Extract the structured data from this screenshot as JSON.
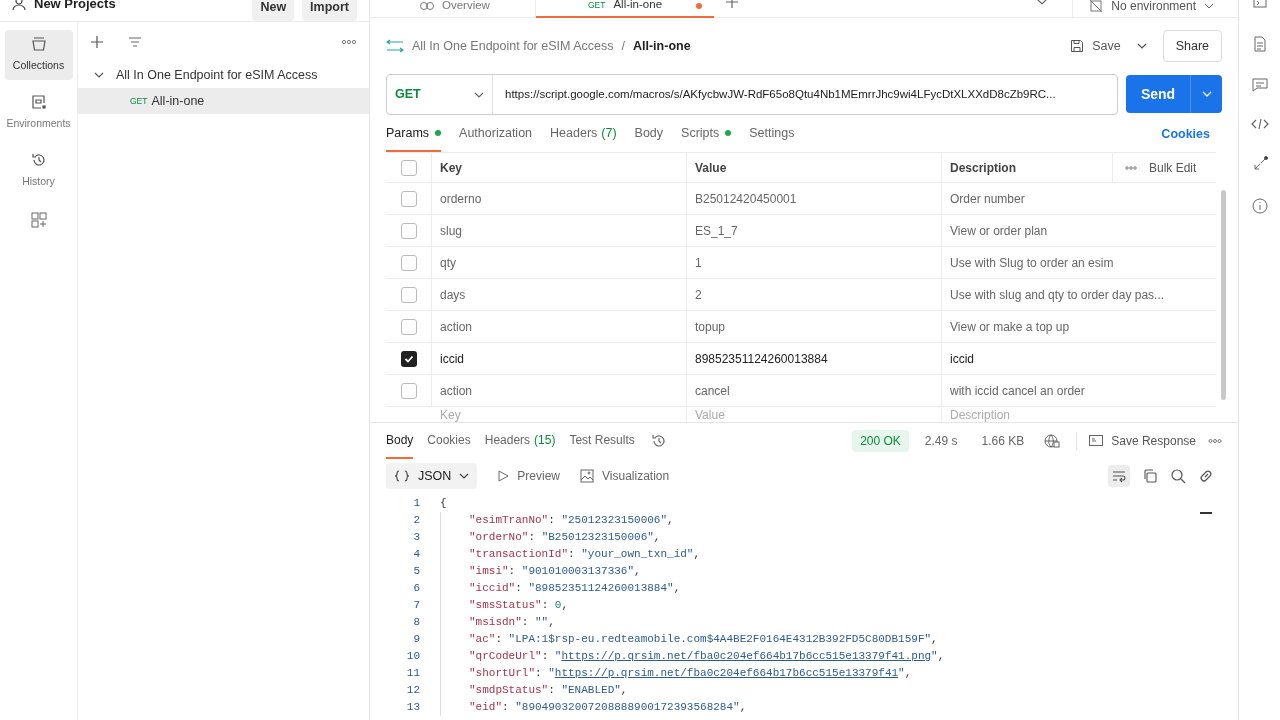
{
  "workspace": {
    "name": "New Projects",
    "buttons": [
      "New",
      "Import"
    ]
  },
  "rail": [
    {
      "label": "Collections",
      "kind": "collections",
      "selected": true
    },
    {
      "label": "Environments",
      "kind": "environments",
      "selected": false
    },
    {
      "label": "History",
      "kind": "history",
      "selected": false
    }
  ],
  "sidebar": {
    "collections": [
      {
        "name": "All In One Endpoint for eSIM Access",
        "expanded": true,
        "children": [
          {
            "method": "GET",
            "name": "All-in-one",
            "selected": true
          }
        ]
      }
    ]
  },
  "tabs": [
    {
      "kind": "overview",
      "label": "Overview",
      "selected": false,
      "unsaved": false
    },
    {
      "kind": "request",
      "method": "GET",
      "label": "All-in-one",
      "selected": true,
      "unsaved": true
    }
  ],
  "environment": "No environment",
  "breadcrumb": [
    "All In One Endpoint for eSIM Access",
    "All-in-one"
  ],
  "breadcrumb_separator": "/",
  "save": "Save",
  "share": "Share",
  "request": {
    "method": "GET",
    "url": "https://script.google.com/macros/s/AKfycbwJW-RdF65o8Qtu4Nb1MEmrrJhc9wi4LFycDtXLXXdD8cZb9RC...",
    "send": "Send"
  },
  "request_tabs": [
    {
      "label": "Params",
      "dot": true,
      "selected": true
    },
    {
      "label": "Authorization",
      "dot": false,
      "selected": false
    },
    {
      "label": "Headers",
      "count": "(7)",
      "dot": false,
      "selected": false
    },
    {
      "label": "Body",
      "dot": false,
      "selected": false
    },
    {
      "label": "Scripts",
      "dot": true,
      "selected": false
    },
    {
      "label": "Settings",
      "dot": false,
      "selected": false
    }
  ],
  "cookies": "Cookies",
  "params": {
    "columns": [
      "Key",
      "Value",
      "Description"
    ],
    "bulk_edit": "Bulk Edit",
    "all_checked": false,
    "rows": [
      {
        "key": "orderno",
        "value": "B25012420450001",
        "description": "Order number",
        "checked": false
      },
      {
        "key": "slug",
        "value": "ES_1_7",
        "description": "View or order plan",
        "checked": false
      },
      {
        "key": "qty",
        "value": "1",
        "description": "Use with Slug to order an esim",
        "checked": false
      },
      {
        "key": "days",
        "value": "2",
        "description": "Use with slug and qty to order day pas...",
        "checked": false
      },
      {
        "key": "action",
        "value": "topup",
        "description": "View or make a top up",
        "checked": false
      },
      {
        "key": "iccid",
        "value": "89852351124260013884",
        "description": "iccid",
        "checked": true
      },
      {
        "key": "action",
        "value": "cancel",
        "description": "with iccid cancel an order",
        "checked": false
      }
    ],
    "new_row": {
      "key": "Key",
      "value": "Value",
      "description": "Description"
    }
  },
  "response": {
    "tabs": [
      {
        "label": "Body",
        "selected": true
      },
      {
        "label": "Cookies",
        "selected": false
      },
      {
        "label": "Headers",
        "count": "(15)",
        "selected": false
      },
      {
        "label": "Test Results",
        "selected": false
      }
    ],
    "status": "200 OK",
    "time": "2.49 s",
    "size": "1.66 KB",
    "save_response": "Save Response",
    "format": "JSON",
    "views": [
      "Preview",
      "Visualization"
    ],
    "lines": [
      {
        "num": "1",
        "segments": [
          {
            "t": "{",
            "kind": "punct"
          }
        ]
      },
      {
        "num": "2",
        "segments": [
          {
            "t": "\"esimTranNo\"",
            "kind": "key"
          },
          {
            "t": ": ",
            "kind": "punct"
          },
          {
            "t": "\"25012323150006\"",
            "kind": "string"
          },
          {
            "t": ",",
            "kind": "punct"
          }
        ]
      },
      {
        "num": "3",
        "segments": [
          {
            "t": "\"orderNo\"",
            "kind": "key"
          },
          {
            "t": ": ",
            "kind": "punct"
          },
          {
            "t": "\"B25012323150006\"",
            "kind": "string"
          },
          {
            "t": ",",
            "kind": "punct"
          }
        ]
      },
      {
        "num": "4",
        "segments": [
          {
            "t": "\"transactionId\"",
            "kind": "key"
          },
          {
            "t": ": ",
            "kind": "punct"
          },
          {
            "t": "\"your_own_txn_id\"",
            "kind": "string"
          },
          {
            "t": ",",
            "kind": "punct"
          }
        ]
      },
      {
        "num": "5",
        "segments": [
          {
            "t": "\"imsi\"",
            "kind": "key"
          },
          {
            "t": ": ",
            "kind": "punct"
          },
          {
            "t": "\"901010003137336\"",
            "kind": "string"
          },
          {
            "t": ",",
            "kind": "punct"
          }
        ]
      },
      {
        "num": "6",
        "segments": [
          {
            "t": "\"iccid\"",
            "kind": "key"
          },
          {
            "t": ": ",
            "kind": "punct"
          },
          {
            "t": "\"89852351124260013884\"",
            "kind": "string"
          },
          {
            "t": ",",
            "kind": "punct"
          }
        ]
      },
      {
        "num": "7",
        "segments": [
          {
            "t": "\"smsStatus\"",
            "kind": "key"
          },
          {
            "t": ": ",
            "kind": "punct"
          },
          {
            "t": "0",
            "kind": "number"
          },
          {
            "t": ",",
            "kind": "punct"
          }
        ]
      },
      {
        "num": "8",
        "segments": [
          {
            "t": "\"msisdn\"",
            "kind": "key"
          },
          {
            "t": ": ",
            "kind": "punct"
          },
          {
            "t": "\"\"",
            "kind": "string"
          },
          {
            "t": ",",
            "kind": "punct"
          }
        ]
      },
      {
        "num": "9",
        "segments": [
          {
            "t": "\"ac\"",
            "kind": "key"
          },
          {
            "t": ": ",
            "kind": "punct"
          },
          {
            "t": "\"LPA:1$rsp-eu.redteamobile.com$4A4BE2F0164E4312B392FD5C80DB159F\"",
            "kind": "string"
          },
          {
            "t": ",",
            "kind": "punct"
          }
        ]
      },
      {
        "num": "10",
        "segments": [
          {
            "t": "\"qrCodeUrl\"",
            "kind": "key"
          },
          {
            "t": ": ",
            "kind": "punct"
          },
          {
            "t": "\"",
            "kind": "string"
          },
          {
            "t": "https://p.qrsim.net/fba0c204ef664b17b6cc515e13379f41.png",
            "kind": "link"
          },
          {
            "t": "\"",
            "kind": "string"
          },
          {
            "t": ",",
            "kind": "punct"
          }
        ]
      },
      {
        "num": "11",
        "segments": [
          {
            "t": "\"shortUrl\"",
            "kind": "key"
          },
          {
            "t": ": ",
            "kind": "punct"
          },
          {
            "t": "\"",
            "kind": "string"
          },
          {
            "t": "https://p.qrsim.net/fba0c204ef664b17b6cc515e13379f41",
            "kind": "link"
          },
          {
            "t": "\"",
            "kind": "string"
          },
          {
            "t": ",",
            "kind": "punct"
          }
        ]
      },
      {
        "num": "12",
        "segments": [
          {
            "t": "\"smdpStatus\"",
            "kind": "key"
          },
          {
            "t": ": ",
            "kind": "punct"
          },
          {
            "t": "\"ENABLED\"",
            "kind": "string"
          },
          {
            "t": ",",
            "kind": "punct"
          }
        ]
      },
      {
        "num": "13",
        "segments": [
          {
            "t": "\"eid\"",
            "kind": "key"
          },
          {
            "t": ": ",
            "kind": "punct"
          },
          {
            "t": "\"89049032007208888900172393568284\"",
            "kind": "string"
          },
          {
            "t": ",",
            "kind": "punct"
          }
        ]
      }
    ]
  }
}
